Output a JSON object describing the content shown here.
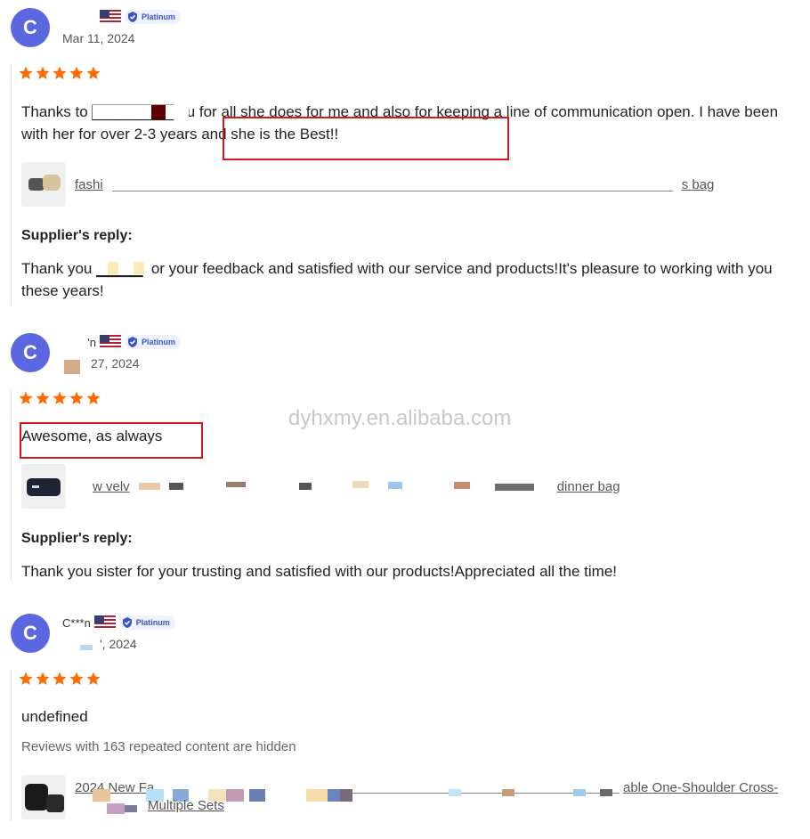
{
  "reviews": [
    {
      "avatar_letter": "C",
      "username": "",
      "badge": "Platinum",
      "date": "Mar 11, 2024",
      "rating": 5,
      "text": "Thanks to ▇▇▇▇▇▇▇ Yu for all she does for me and also for keeping a line of communication open. I have been with her for over 2-3 years and she is the Best!!",
      "product": "fashi",
      "product_tail": "s bag",
      "supplier_reply_title": "Supplier's reply:",
      "supplier_reply": "Thank you ▇▇▇▇ for your feedback and satisfied with our service and products!It's pleasure to working with you these years!"
    },
    {
      "avatar_letter": "C",
      "username": "'n",
      "badge": "Platinum",
      "date": "27, 2024",
      "rating": 5,
      "text": "Awesome, as always",
      "product": "w velv",
      "product_tail": "dinner bag",
      "supplier_reply_title": "Supplier's reply:",
      "supplier_reply": "Thank you sister for your trusting and satisfied with our products!Appreciated all the time!"
    },
    {
      "avatar_letter": "C",
      "username": "C***n",
      "badge": "Platinum",
      "date": "', 2024",
      "rating": 5,
      "text": "undefined",
      "hidden_note": "Reviews with 163 repeated content are hidden",
      "product": "2024 New Fa",
      "product_tail": "able One-Shoulder Cross-",
      "product_line2": "Multiple Sets"
    }
  ],
  "watermark": "dyhxmy.en.alibaba.com",
  "colors": {
    "avatar": "#5a67e0",
    "star": "#ff6a00",
    "highlight": "#d9161c"
  }
}
